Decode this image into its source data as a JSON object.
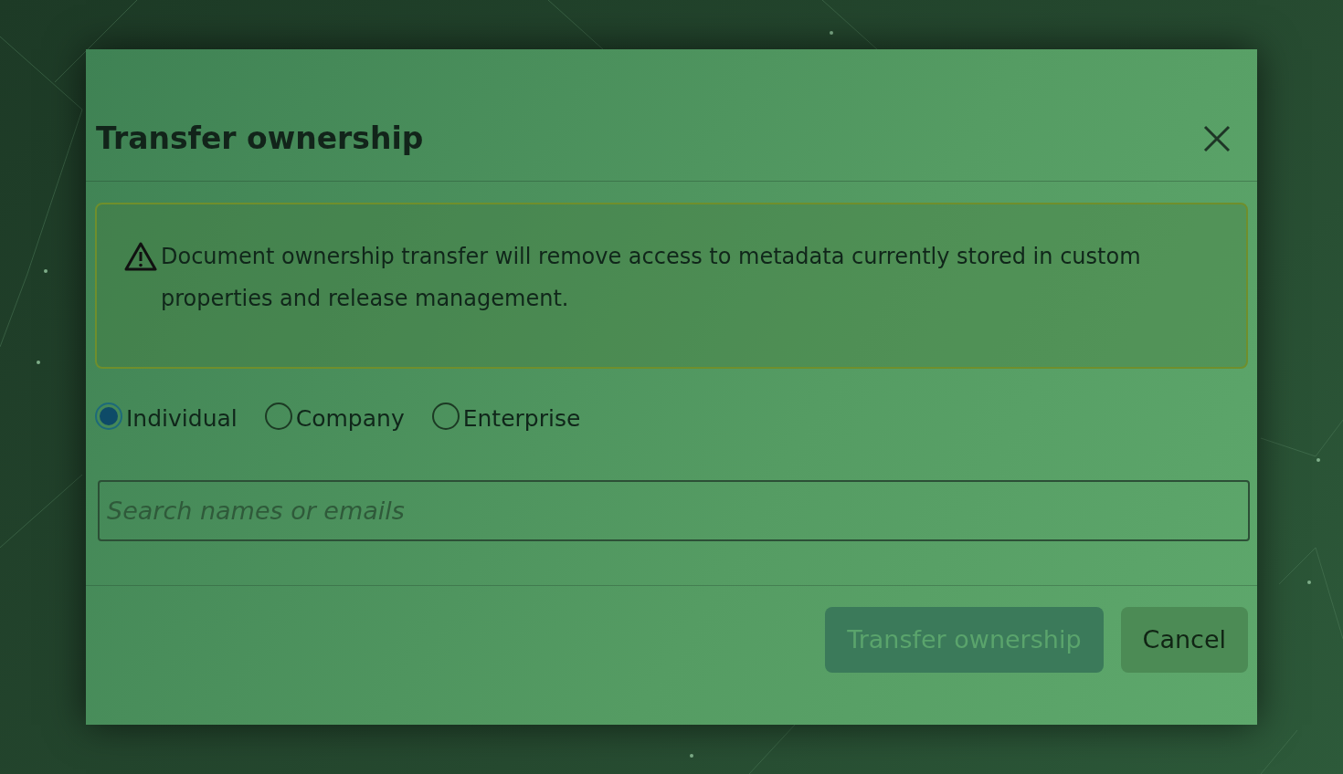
{
  "dialog": {
    "title": "Transfer ownership",
    "alert": {
      "text": "Document ownership transfer will remove access to metadata currently stored in custom properties and release management."
    },
    "owner_types": [
      {
        "label": "Individual",
        "selected": true
      },
      {
        "label": "Company",
        "selected": false
      },
      {
        "label": "Enterprise",
        "selected": false
      }
    ],
    "search": {
      "placeholder": "Search names or emails"
    },
    "buttons": [
      {
        "label": "Transfer ownership",
        "kind": "primary",
        "disabled": true
      },
      {
        "label": "Cancel",
        "kind": "secondary",
        "disabled": false
      }
    ]
  }
}
